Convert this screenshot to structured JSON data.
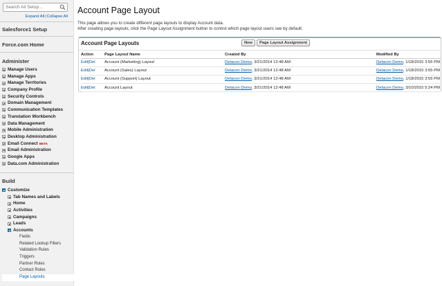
{
  "sidebar": {
    "search_placeholder": "Search All Setup...",
    "expand_all": "Expand All",
    "collapse_all": "Collapse All",
    "sections": {
      "salesforce1": "Salesforce1 Setup",
      "forcecom": "Force.com Home",
      "administer": "Administer",
      "build": "Build"
    },
    "administer_items": [
      "Manage Users",
      "Manage Apps",
      "Manage Territories",
      "Company Profile",
      "Security Controls",
      "Domain Management",
      "Communication Templates",
      "Translation Workbench",
      "Data Management",
      "Mobile Administration",
      "Desktop Administration",
      "Email Connect",
      "Email Administration",
      "Google Apps",
      "Data.com Administration"
    ],
    "beta_label": "BETA",
    "build_tree": {
      "customize": "Customize",
      "children": [
        "Tab Names and Labels",
        "Home",
        "Activities",
        "Campaigns",
        "Leads"
      ],
      "accounts": "Accounts",
      "account_children": [
        "Fields",
        "Related Lookup Filters",
        "Validation Rules",
        "Triggers",
        "Partner Roles",
        "Contact Roles",
        "Page Layouts"
      ]
    }
  },
  "main": {
    "title": "Account Page Layout",
    "desc1": "This page allows you to create different page layouts to display Account data.",
    "desc2": "After creating page layouts, click the Page Layout Assignment button to control which page layout users see by default.",
    "panel_title": "Account Page Layouts",
    "btn_new": "New",
    "btn_assignment": "Page Layout Assignment",
    "headers": [
      "Action",
      "Page Layout Name",
      "Created By",
      "Modified By"
    ],
    "edit": "Edit",
    "sep": "|",
    "del": "Del",
    "rows": [
      {
        "name": "Account (Marketing) Layout",
        "created_user": "Delacon Demo",
        "created_date": ", 3/21/2014 12:48 AM",
        "modified_user": "Delacon Demo",
        "modified_date": ", 1/18/2015 3:55 PM"
      },
      {
        "name": "Account (Sales) Layout",
        "created_user": "Delacon Demo",
        "created_date": ", 3/21/2014 12:48 AM",
        "modified_user": "Delacon Demo",
        "modified_date": ", 1/18/2015 3:55 PM"
      },
      {
        "name": "Account (Support) Layout",
        "created_user": "Delacon Demo",
        "created_date": ", 3/21/2014 12:48 AM",
        "modified_user": "Delacon Demo",
        "modified_date": ", 1/18/2015 3:55 PM"
      },
      {
        "name": "Account Layout",
        "created_user": "Delacon Demo",
        "created_date": ", 3/21/2014 12:48 AM",
        "modified_user": "Delacon Demo",
        "modified_date": ", 3/10/2015 5:24 PM"
      }
    ]
  },
  "colors": {
    "link": "#015ba7",
    "sidebar_bg": "#f1f1f1",
    "tree_toggle": "#1e88b5",
    "beta": "#cc0000"
  }
}
